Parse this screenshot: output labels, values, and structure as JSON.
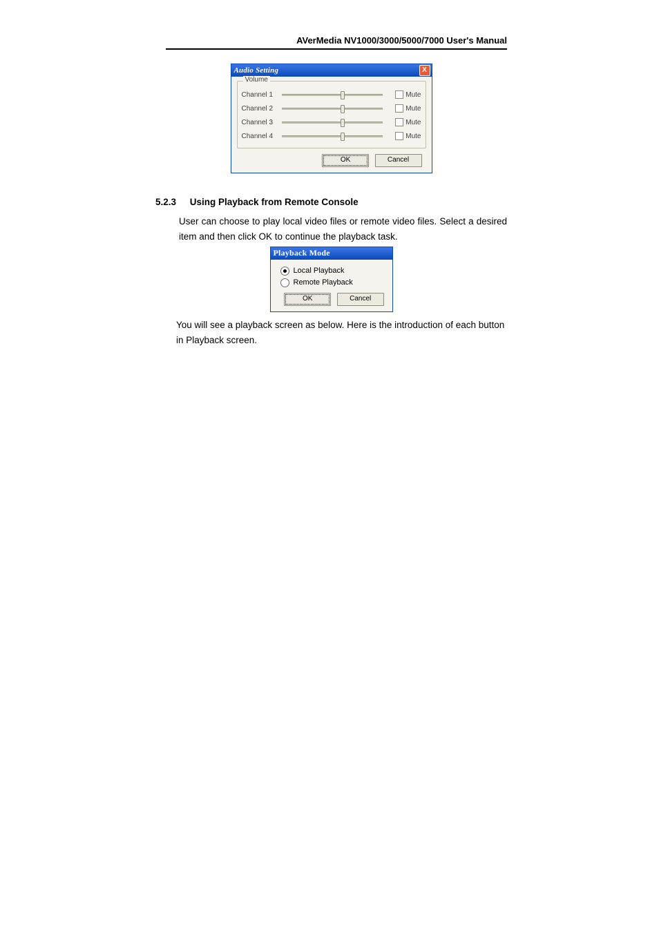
{
  "header": {
    "title": "AVerMedia NV1000/3000/5000/7000 User's Manual"
  },
  "audio_dialog": {
    "title": "Audio Setting",
    "close": "X",
    "group_label": "Volume",
    "channels": [
      {
        "label": "Channel 1",
        "mute": "Mute"
      },
      {
        "label": "Channel 2",
        "mute": "Mute"
      },
      {
        "label": "Channel 3",
        "mute": "Mute"
      },
      {
        "label": "Channel 4",
        "mute": "Mute"
      }
    ],
    "ok": "OK",
    "cancel": "Cancel"
  },
  "section": {
    "number": "5.2.3",
    "title": "Using Playback from Remote Console",
    "p1": "User can choose to play local video files or remote video files. Select a desired item and then click OK to continue the playback task.",
    "p2": "You will see a playback screen as below. Here is the introduction of each button in Playback screen."
  },
  "playback_dialog": {
    "title": "Playback Mode",
    "opt_local": "Local Playback",
    "opt_remote": "Remote Playback",
    "ok": "OK",
    "cancel": "Cancel"
  }
}
